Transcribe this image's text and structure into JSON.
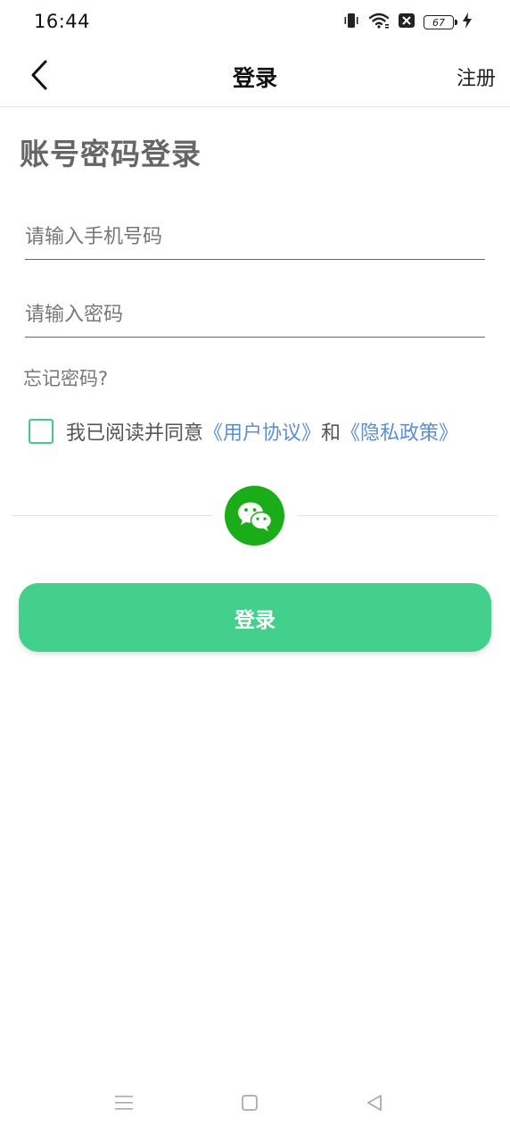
{
  "status_bar": {
    "time": "16:44",
    "battery_level": "67",
    "icons": [
      "vibrate-icon",
      "wifi-icon",
      "sim-off-icon",
      "battery-icon",
      "charging-icon"
    ]
  },
  "nav": {
    "title": "登录",
    "register_label": "注册",
    "back_icon": "chevron-left-icon"
  },
  "main": {
    "section_title": "账号密码登录",
    "phone_placeholder": "请输入手机号码",
    "password_placeholder": "请输入密码",
    "forgot_label": "忘记密码?",
    "agreement": {
      "prefix": "我已阅读并同意",
      "user_agreement": "《用户协议》",
      "and": "和",
      "privacy_policy": "《隐私政策》"
    },
    "wechat_icon": "wechat-icon",
    "login_label": "登录"
  },
  "colors": {
    "accent": "#43d08c",
    "checkbox_border": "#43c98a",
    "link": "#5b8fd0",
    "wechat": "#1aad19"
  }
}
